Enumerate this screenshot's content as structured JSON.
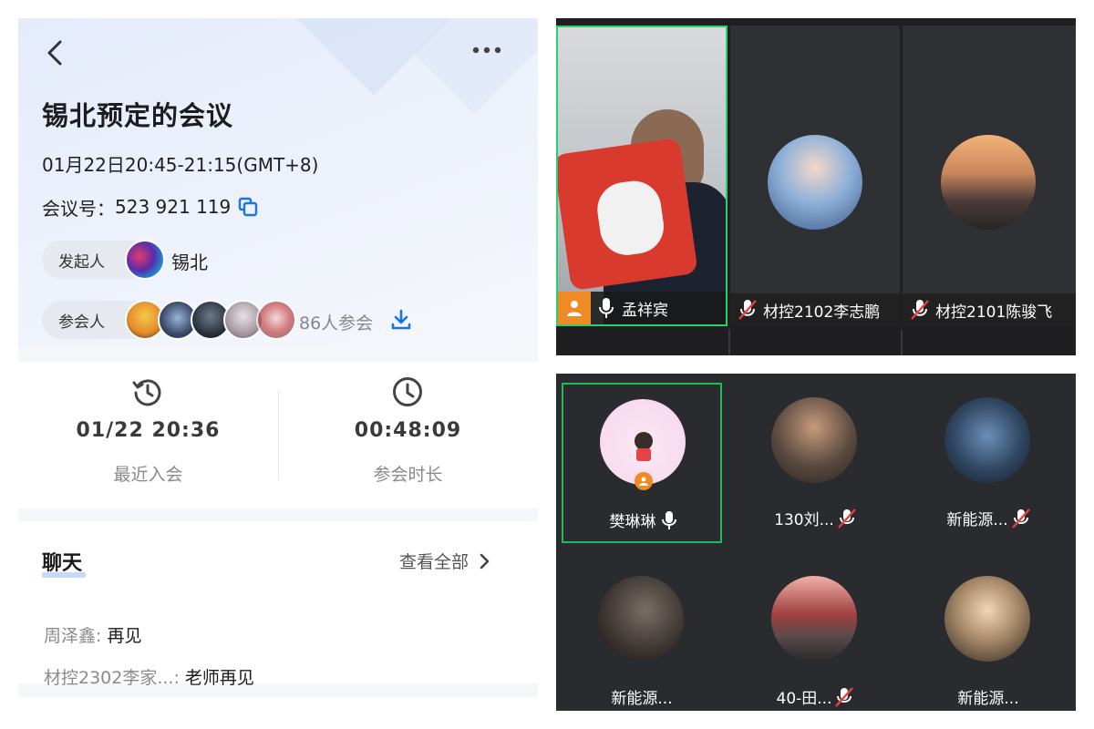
{
  "left": {
    "title": "锡北预定的会议",
    "time": "01月22日20:45-21:15(GMT+8)",
    "meeting_id_label": "会议号：",
    "meeting_id": "523 921 119",
    "host_label": "发起人",
    "host_name": "锡北",
    "attendees_label": "参会人",
    "attendee_count": "86人参会",
    "stats": [
      {
        "value": "01/22 20:36",
        "label": "最近入会",
        "icon": "history-clock-icon"
      },
      {
        "value": "00:48:09",
        "label": "参会时长",
        "icon": "clock-icon"
      }
    ],
    "chat": {
      "title": "聊天",
      "view_all": "查看全部",
      "messages": [
        {
          "sender": "周泽鑫: ",
          "text": "再见"
        },
        {
          "sender": "材控2302李家...: ",
          "text": "老师再见"
        }
      ]
    }
  },
  "video_top": {
    "tiles": [
      {
        "name": "孟祥宾",
        "mic": "on",
        "host": true
      },
      {
        "name": "材控2102李志鹏",
        "mic": "muted"
      },
      {
        "name": "材控2101陈骏飞",
        "mic": "muted"
      }
    ]
  },
  "video_grid": {
    "tiles": [
      {
        "name": "樊琳琳",
        "mic": "on",
        "host": true
      },
      {
        "name": "130刘...",
        "mic": "muted"
      },
      {
        "name": "新能源...",
        "mic": "muted"
      },
      {
        "name": "新能源...",
        "mic": "none"
      },
      {
        "name": "40-田...",
        "mic": "muted"
      },
      {
        "name": "新能源...",
        "mic": "none"
      }
    ]
  },
  "colors": {
    "accent_blue": "#1a73e8",
    "active_border": "#2bd06e",
    "host_badge": "#f08a24"
  }
}
